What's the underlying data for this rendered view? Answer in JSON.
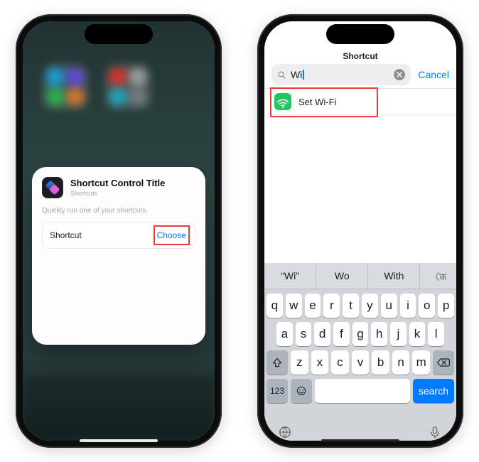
{
  "left": {
    "card": {
      "title": "Shortcut Control Title",
      "subtitle": "Shortcuts",
      "description": "Quickly run one of your shortcuts.",
      "row_label": "Shortcut",
      "choose_label": "Choose"
    }
  },
  "right": {
    "nav_title": "Shortcut",
    "search": {
      "value": "Wi",
      "cancel_label": "Cancel"
    },
    "results": [
      {
        "label": "Set Wi-Fi"
      }
    ],
    "suggestions": {
      "s1": "“Wi”",
      "s2": "Wo",
      "s3": "With",
      "s4": "〈क"
    },
    "keys": {
      "row1": [
        "q",
        "w",
        "e",
        "r",
        "t",
        "y",
        "u",
        "i",
        "o",
        "p"
      ],
      "row2": [
        "a",
        "s",
        "d",
        "f",
        "g",
        "h",
        "j",
        "k",
        "l"
      ],
      "row3": [
        "z",
        "x",
        "c",
        "v",
        "b",
        "n",
        "m"
      ],
      "numkey": "123",
      "search_label": "search"
    }
  }
}
